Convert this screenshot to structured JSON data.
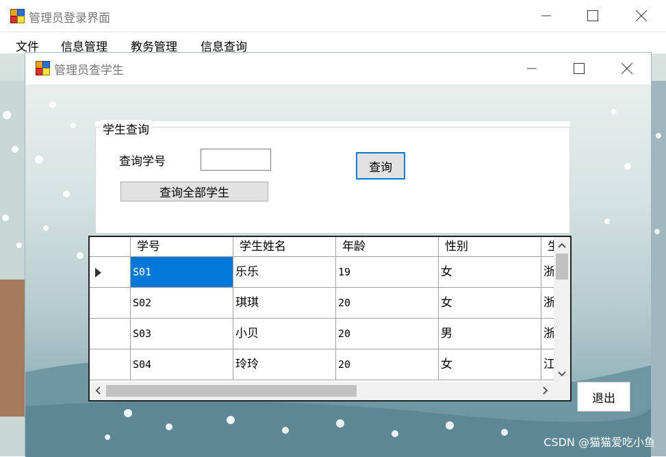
{
  "main_window": {
    "title": "管理员登录界面",
    "menu": [
      "文件",
      "信息管理",
      "教务管理",
      "信息查询"
    ]
  },
  "child_window": {
    "title": "管理员查学生",
    "group": {
      "legend": "学生查询",
      "id_label": "查询学号",
      "id_value": "",
      "query_button": "查询",
      "query_all_button": "查询全部学生"
    },
    "grid": {
      "columns": [
        "学号",
        "学生姓名",
        "年龄",
        "性别",
        "生"
      ],
      "rows": [
        {
          "id": "S01",
          "name": "乐乐",
          "age": "19",
          "gender": "女",
          "origin": "浙"
        },
        {
          "id": "S02",
          "name": "琪琪",
          "age": "20",
          "gender": "女",
          "origin": "浙"
        },
        {
          "id": "S03",
          "name": "小贝",
          "age": "20",
          "gender": "男",
          "origin": "浙"
        },
        {
          "id": "S04",
          "name": "玲玲",
          "age": "20",
          "gender": "女",
          "origin": "江"
        }
      ],
      "selected_row": 0
    },
    "exit_button": "退出"
  },
  "watermark": "CSDN @猫猫爱吃小鱼",
  "colors": {
    "selection": "#0078d7",
    "button_focus_border": "#0078d7"
  }
}
